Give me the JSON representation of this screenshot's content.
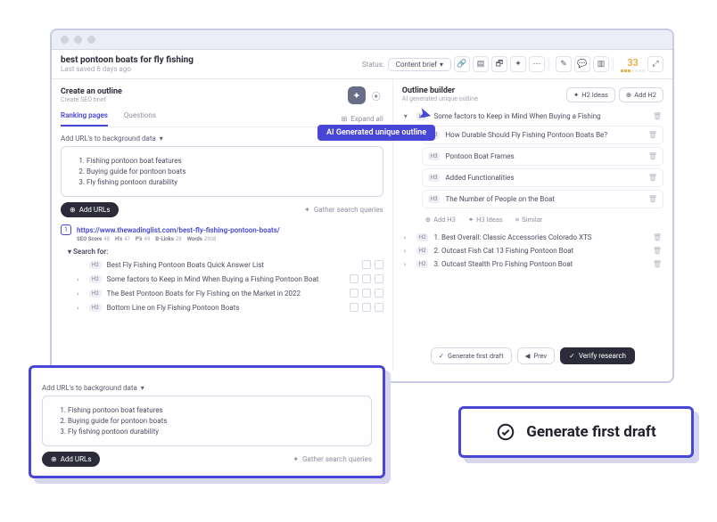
{
  "header": {
    "title": "best pontoon boats for fly fishing",
    "saved": "6 days ago",
    "status_label": "Status:",
    "status_value": "Content brief",
    "score": "33"
  },
  "left": {
    "title": "Create an outline",
    "sub": "Create SEO brief",
    "tabs": {
      "ranking": "Ranking pages",
      "questions": "Questions"
    },
    "expand_all": "Expand all",
    "add_urls_label": "Add URL's to background data",
    "bg_items": [
      "Fishing pontoon boat features",
      "Buying guide for pontoon boats",
      "Fly fishing pontoon durability"
    ],
    "add_urls_btn": "Add URLs",
    "gather": "Gather search queries",
    "url": {
      "idx": "1",
      "text": "https://www.thewadinglist.com/best-fly-fishing-pontoon-boats/",
      "stats": {
        "seo": "SEO Score",
        "seo_v": "48",
        "hs": "H's",
        "hs_v": "47",
        "ps": "P's",
        "ps_v": "49",
        "bl": "B-Links",
        "bl_v": "28",
        "words": "Words",
        "words_v": "2908"
      }
    },
    "search_for": "Search for:",
    "tree": [
      {
        "chev": "",
        "h": "H2",
        "text": "Best Fly Fishing Pontoon Boats Quick Answer List"
      },
      {
        "chev": "›",
        "h": "H2",
        "text": "Some factors to Keep in Mind When Buying a Fishing Pontoon Boat"
      },
      {
        "chev": "›",
        "h": "H2",
        "text": "The Best Pontoon Boats for Fly Fishing on the Market in 2022"
      },
      {
        "chev": "›",
        "h": "H2",
        "text": "Bottom Line on Fly Fishing Pontoon Boats"
      }
    ]
  },
  "right": {
    "title": "Outline builder",
    "sub": "AI generated unique outline",
    "h2_ideas": "H2 Ideas",
    "add_h2": "Add H2",
    "callout": "AI Generated unique outline",
    "root": "Some factors to Keep in Mind When Buying a Fishing",
    "children": [
      "How Durable Should Fly Fishing Pontoon Boats Be?",
      "Pontoon Boat Frames",
      "Added Functionalities",
      "The Number of People on the Boat"
    ],
    "sub_actions": {
      "add_h3": "Add H3",
      "h3_ideas": "H3 Ideas",
      "similar": "Similar"
    },
    "siblings": [
      "1. Best Overall: Classic Accessories Colorado XTS",
      "2. Outcast Fish Cat 13 Fishing Pontoon Boat",
      "3. Outcast Stealth Pro Fishing Pontoon Boat"
    ],
    "bottom": {
      "gen": "Generate first draft",
      "prev": "Prev",
      "verify": "Verify research"
    }
  },
  "overlay_big": "Generate first draft"
}
